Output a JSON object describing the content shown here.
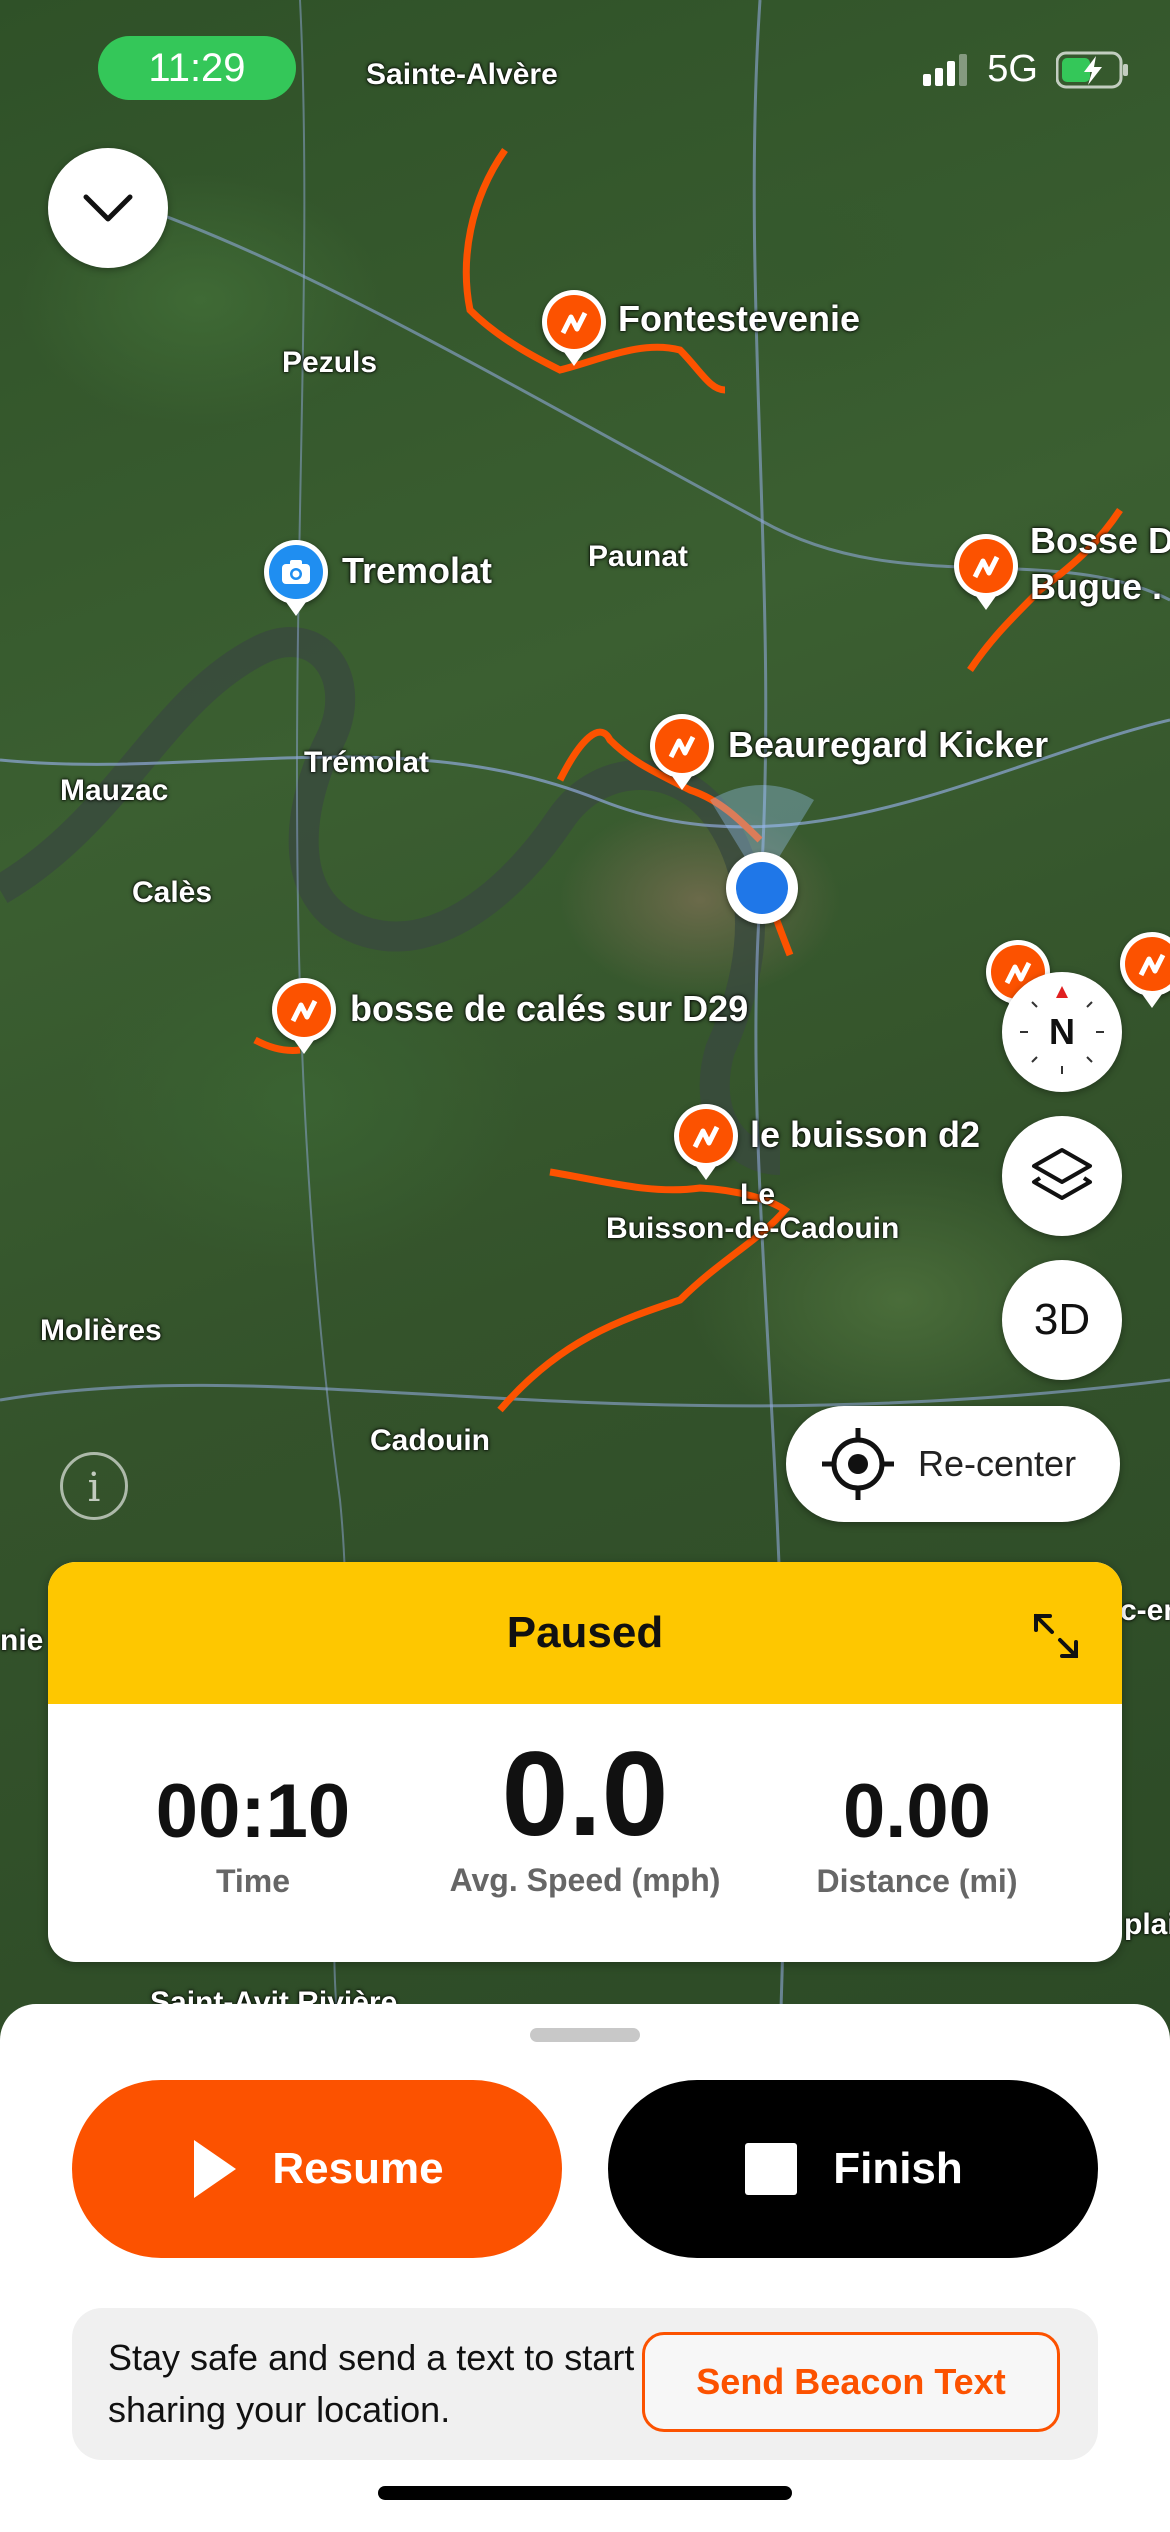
{
  "status_bar": {
    "time": "11:29",
    "network": "5G",
    "charging": true
  },
  "map": {
    "places": {
      "sainte_alvere": "Sainte-Alvère",
      "pezuls": "Pezuls",
      "paunat": "Paunat",
      "tremolat_town": "Trémolat",
      "mauzac": "Mauzac",
      "cales": "Calès",
      "le": "Le",
      "buisson_de_cadouin": "Buisson-de-Cadouin",
      "molieres": "Molières",
      "cadouin": "Cadouin",
      "saint_avit": "Saint-Avit Rivière",
      "edge_left": "nie",
      "edge_right_1": "c-en",
      "edge_right_2": "plai"
    },
    "segments": {
      "fontestevenie": "Fontestevenie",
      "bosse_line1": "Bosse D",
      "bosse_line2": "Bugue .",
      "beauregard": "Beauregard Kicker",
      "bosse_cales": "bosse de calés sur D29",
      "le_buisson": "le buisson d2"
    },
    "photo_pin_label": "Tremolat",
    "compass_label": "N",
    "mode_3d_label": "3D",
    "recenter_label": "Re-center",
    "info_label": "i"
  },
  "stats": {
    "status": "Paused",
    "time_value": "00:10",
    "time_label": "Time",
    "speed_value": "0.0",
    "speed_label": "Avg. Speed (mph)",
    "distance_value": "0.00",
    "distance_label": "Distance (mi)"
  },
  "actions": {
    "resume_label": "Resume",
    "finish_label": "Finish",
    "beacon_message": "Stay safe and send a text to start sharing your location.",
    "beacon_button": "Send Beacon Text"
  },
  "colors": {
    "accent": "#fc5200",
    "paused_banner": "#fec700",
    "status_green": "#34c759",
    "location_blue": "#1f8ef1"
  }
}
